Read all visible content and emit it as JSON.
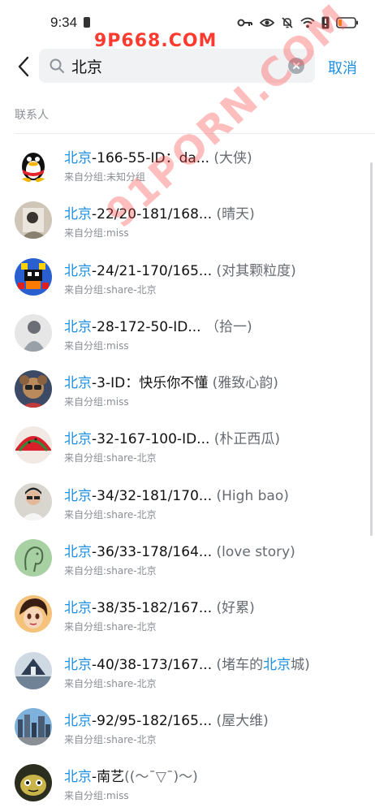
{
  "status_bar": {
    "time": "9:34",
    "icons": [
      "key-icon",
      "eye-icon",
      "mute-bell-icon",
      "wifi-icon",
      "alert-icon",
      "battery-icon"
    ]
  },
  "watermark": {
    "top_text": "9P668.COM",
    "diagonal_text": "91PORN.COM"
  },
  "search": {
    "query": "北京",
    "cancel_label": "取消"
  },
  "section_label": "联系人",
  "contacts": [
    {
      "kw": "北京",
      "name": "-166-55-ID：da...",
      "remark": " (大侠)",
      "remark_kw": "",
      "remark_end": "",
      "group_prefix": "来自分组:",
      "group": "未知分组"
    },
    {
      "kw": "北京",
      "name": "-22/20-181/168...",
      "remark": " (晴天)",
      "remark_kw": "",
      "remark_end": "",
      "group_prefix": "来自分组:",
      "group": "miss"
    },
    {
      "kw": "北京",
      "name": "-24/21-170/165...",
      "remark": " (对其颗粒度)",
      "remark_kw": "",
      "remark_end": "",
      "group_prefix": "来自分组:",
      "group": "share-北京"
    },
    {
      "kw": "北京",
      "name": "-28-172-50-ID...",
      "remark": " （拾一)",
      "remark_kw": "",
      "remark_end": "",
      "group_prefix": "来自分组:",
      "group": "miss"
    },
    {
      "kw": "北京",
      "name": "-3-ID：快乐你不懂",
      "remark": " (雅致心韵)",
      "remark_kw": "",
      "remark_end": "",
      "group_prefix": "来自分组:",
      "group": "miss"
    },
    {
      "kw": "北京",
      "name": "-32-167-100-ID...",
      "remark": " (朴正西瓜)",
      "remark_kw": "",
      "remark_end": "",
      "group_prefix": "来自分组:",
      "group": "share-北京"
    },
    {
      "kw": "北京",
      "name": "-34/32-181/170...",
      "remark": " (High bao)",
      "remark_kw": "",
      "remark_end": "",
      "group_prefix": "来自分组:",
      "group": "share-北京"
    },
    {
      "kw": "北京",
      "name": "-36/33-178/164...",
      "remark": " (love story)",
      "remark_kw": "",
      "remark_end": "",
      "group_prefix": "来自分组:",
      "group": "share-北京"
    },
    {
      "kw": "北京",
      "name": "-38/35-182/167...",
      "remark": " (好累)",
      "remark_kw": "",
      "remark_end": "",
      "group_prefix": "来自分组:",
      "group": "share-北京"
    },
    {
      "kw": "北京",
      "name": "-40/38-173/167...",
      "remark": " (堵车的",
      "remark_kw": "北京",
      "remark_end": "城)",
      "group_prefix": "来自分组:",
      "group": "share-北京"
    },
    {
      "kw": "北京",
      "name": "-92/95-182/165...",
      "remark": " (屋大维)",
      "remark_kw": "",
      "remark_end": "",
      "group_prefix": "来自分组:",
      "group": "share-北京"
    },
    {
      "kw": "北京",
      "name": "-南艺",
      "remark": "((～ˉ▽ˉ)～)",
      "remark_kw": "",
      "remark_end": "",
      "group_prefix": "来自分组:",
      "group": "miss"
    }
  ],
  "colors": {
    "accent": "#1d8fe1",
    "watermark": "#ff3b30"
  }
}
